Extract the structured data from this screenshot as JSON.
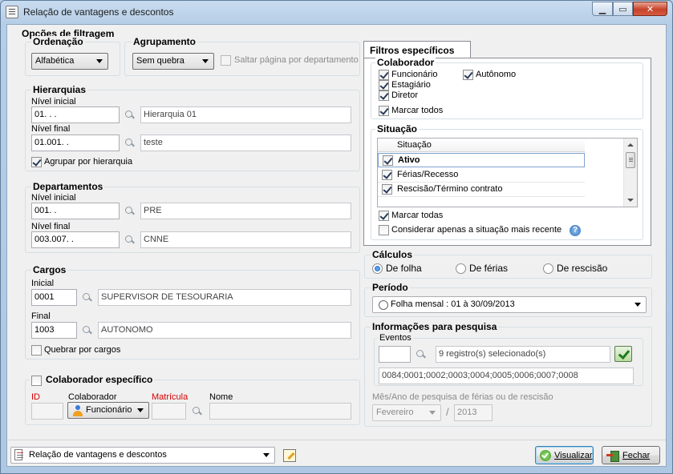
{
  "window": {
    "title": "Relação de vantagens e descontos"
  },
  "filter_options": {
    "title": "Opções de filtragem",
    "ordering": {
      "title": "Ordenação",
      "value": "Alfabética"
    },
    "grouping": {
      "title": "Agrupamento",
      "value": "Sem quebra",
      "skip_page_label": "Saltar página por departamento"
    },
    "hierarchies": {
      "title": "Hierarquias",
      "initial_label": "Nível inicial",
      "initial_code": "01.   .   .",
      "initial_desc": "Hierarquia 01",
      "final_label": "Nível final",
      "final_code": "01.001.   .",
      "final_desc": "teste",
      "group_label": "Agrupar por hierarquia"
    },
    "departments": {
      "title": "Departamentos",
      "initial_label": "Nível inicial",
      "initial_code": "001.   .",
      "initial_desc": "PRE",
      "final_label": "Nível final",
      "final_code": "003.007.   .",
      "final_desc": "CNNE"
    },
    "positions": {
      "title": "Cargos",
      "initial_label": "Inicial",
      "initial_code": "0001",
      "initial_desc": "SUPERVISOR DE TESOURARIA",
      "final_label": "Final",
      "final_code": "1003",
      "final_desc": "AUTONOMO",
      "break_label": "Quebrar por cargos"
    },
    "specific_employee": {
      "title": "Colaborador específico",
      "id_label": "ID",
      "employee_label": "Colaborador",
      "employee_value": "Funcionário",
      "registration_label": "Matrícula",
      "name_label": "Nome"
    }
  },
  "specific_filters": {
    "tab_label": "Filtros específicos",
    "employee": {
      "title": "Colaborador",
      "employee_label": "Funcionário",
      "autonomous_label": "Autônomo",
      "intern_label": "Estagiário",
      "director_label": "Diretor",
      "select_all_label": "Marcar todos"
    },
    "situation": {
      "title": "Situação",
      "column_header": "Situação",
      "rows": [
        {
          "label": "Ativo"
        },
        {
          "label": "Férias/Recesso"
        },
        {
          "label": "Rescisão/Término contrato"
        }
      ],
      "select_all_label": "Marcar todas",
      "latest_label": "Considerar apenas a situação mais recente",
      "help_glyph": "?"
    }
  },
  "calculations": {
    "title": "Cálculos",
    "payroll_label": "De folha",
    "vacation_label": "De férias",
    "termination_label": "De rescisão"
  },
  "period": {
    "title": "Período",
    "value": "Folha mensal : 01 à 30/09/2013"
  },
  "research": {
    "title": "Informações para pesquisa",
    "events_label": "Eventos",
    "events_summary": "9 registro(s) selecionado(s)",
    "events_codes": "0084;0001;0002;0003;0004;0005;0006;0007;0008",
    "month_year_label": "Mês/Ano de pesquisa de férias ou de rescisão",
    "month_value": "Fevereiro",
    "separator": "/",
    "year_value": "2013"
  },
  "footer": {
    "report_value": "Relação de vantagens e descontos",
    "view_label": "Visualizar",
    "close_label": "Fechar"
  }
}
